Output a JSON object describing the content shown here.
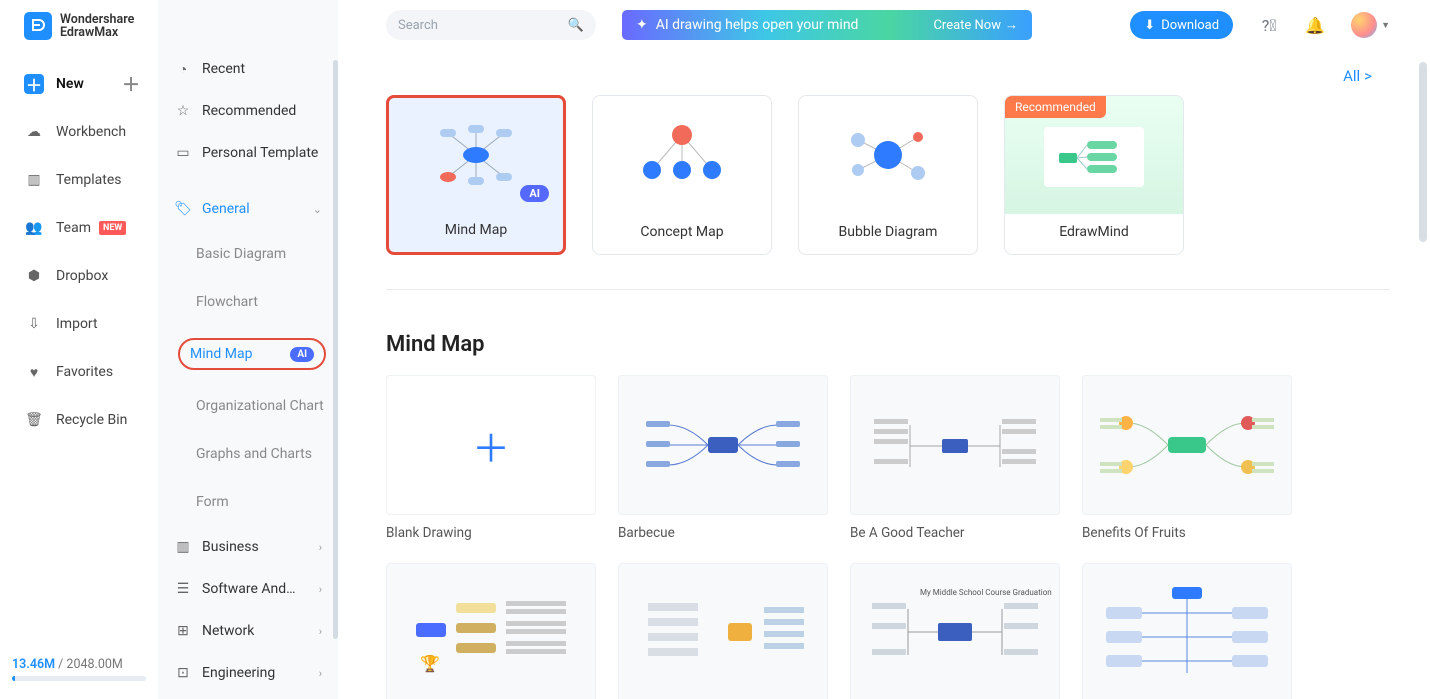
{
  "brand": {
    "top": "Wondershare",
    "bottom": "EdrawMax"
  },
  "rail": {
    "new": "New",
    "workbench": "Workbench",
    "templates": "Templates",
    "team": "Team",
    "team_badge": "NEW",
    "dropbox": "Dropbox",
    "import": "Import",
    "favorites": "Favorites",
    "recycle": "Recycle Bin"
  },
  "storage": {
    "used": "13.46M",
    "sep": " / ",
    "total": "2048.00M"
  },
  "panel": {
    "recent": "Recent",
    "recommended": "Recommended",
    "personal": "Personal Template",
    "general": "General",
    "subs": [
      "Basic Diagram",
      "Flowchart",
      "Mind Map",
      "Organizational Chart",
      "Graphs and Charts",
      "Form"
    ],
    "ai": "AI",
    "cats": [
      "Business",
      "Software And…",
      "Network",
      "Engineering"
    ]
  },
  "search_placeholder": "Search",
  "promo": {
    "text": "AI drawing helps open your mind",
    "cta": "Create Now"
  },
  "download": "Download",
  "all": "All",
  "types": [
    {
      "label": "Mind Map",
      "kind": "mindmap",
      "selected": true,
      "ai": true
    },
    {
      "label": "Concept Map",
      "kind": "concept"
    },
    {
      "label": "Bubble Diagram",
      "kind": "bubble"
    },
    {
      "label": "EdrawMind",
      "kind": "edrawmind",
      "rec": "Recommended"
    }
  ],
  "section": "Mind Map",
  "templates": [
    "Blank Drawing",
    "Barbecue",
    "Be A Good Teacher",
    "Benefits Of Fruits"
  ]
}
